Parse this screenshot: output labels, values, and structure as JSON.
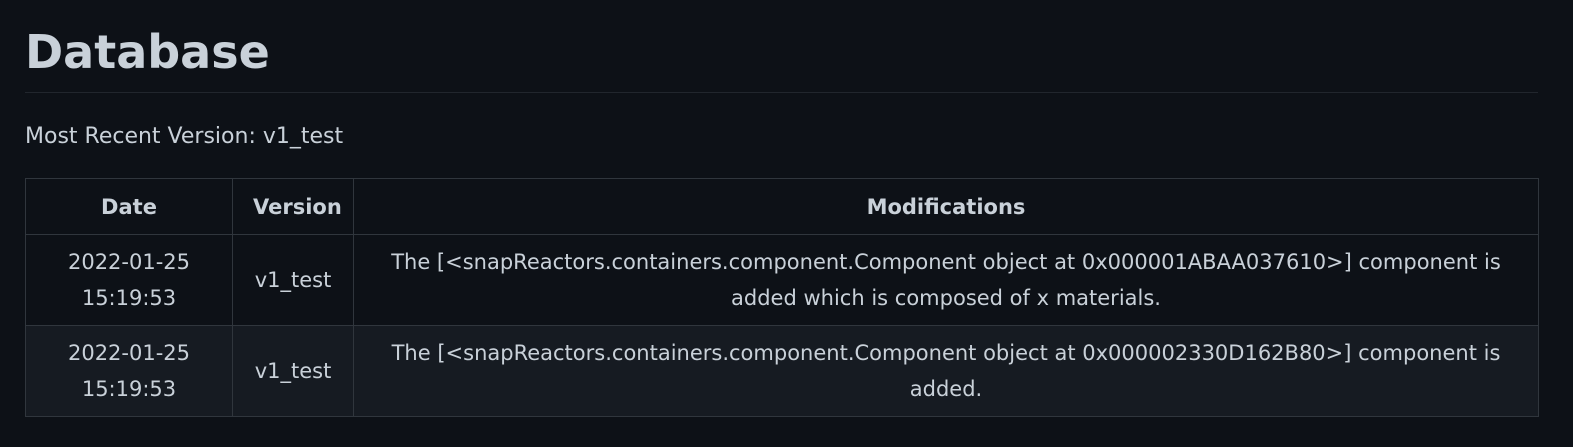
{
  "page": {
    "title": "Database",
    "recent_label": "Most Recent Version: v1_test"
  },
  "table": {
    "headers": [
      "Date",
      "Version",
      "Modifications"
    ],
    "rows": [
      {
        "date": "2022-01-25 15:19:53",
        "version": "v1_test",
        "modifications": "The [<snapReactors.containers.component.Component object at 0x000001ABAA037610>] component is added which is composed of x materials."
      },
      {
        "date": "2022-01-25 15:19:53",
        "version": "v1_test",
        "modifications": "The [<snapReactors.containers.component.Component object at 0x000002330D162B80>] component is added."
      }
    ]
  },
  "colors": {
    "background": "#0d1117",
    "row_alt": "#161b22",
    "border": "#30363d",
    "text": "#c9d1d9"
  }
}
